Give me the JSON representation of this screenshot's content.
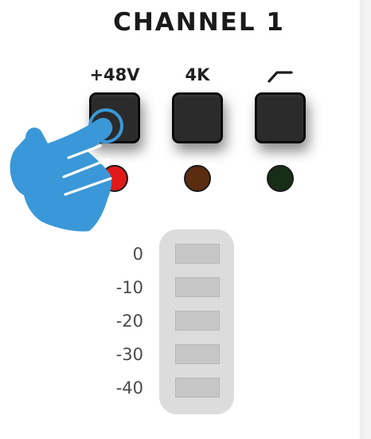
{
  "channel": {
    "title": "CHANNEL 1"
  },
  "buttons": [
    {
      "label": "+48V",
      "led_color": "#e01919"
    },
    {
      "label": "4K",
      "led_color": "#5a2c10"
    },
    {
      "label": "",
      "icon": "high-pass-filter-icon",
      "led_color": "#172d16"
    }
  ],
  "meter": {
    "labels": [
      "0",
      "-10",
      "-20",
      "-30",
      "-40"
    ]
  },
  "overlay": {
    "icon": "pointing-hand-icon",
    "color": "#3a98d8"
  }
}
